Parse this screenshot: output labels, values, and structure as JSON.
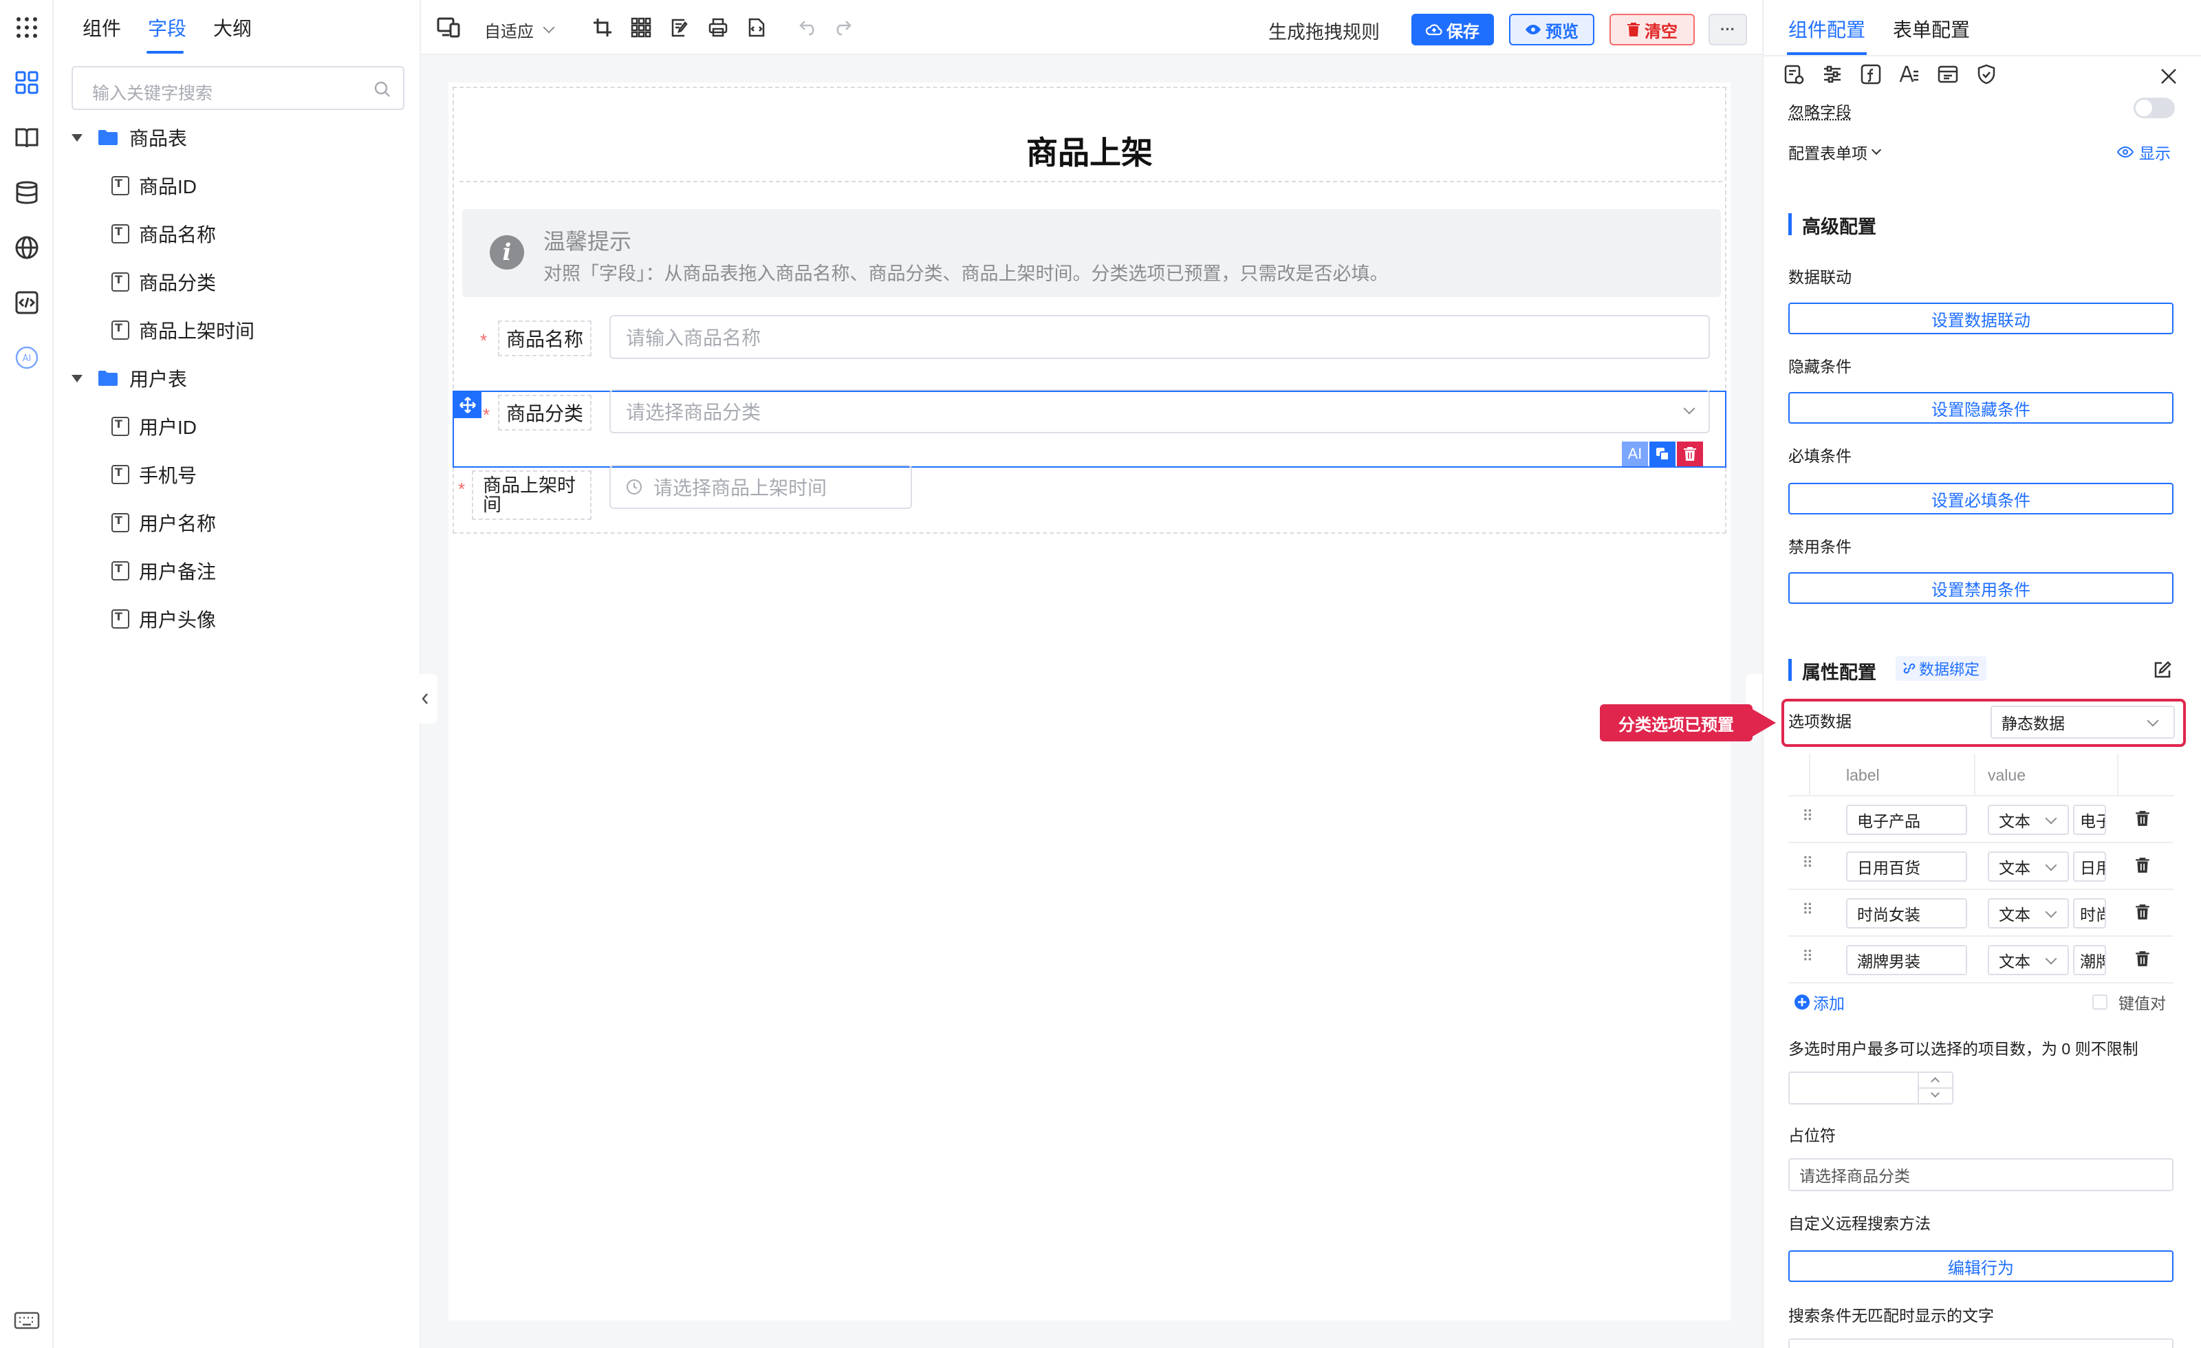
{
  "left_panel": {
    "tabs": [
      "组件",
      "字段",
      "大纲"
    ],
    "active_tab": "字段",
    "search_placeholder": "输入关键字搜索",
    "tree": [
      {
        "name": "商品表",
        "fields": [
          "商品ID",
          "商品名称",
          "商品分类",
          "商品上架时间"
        ]
      },
      {
        "name": "用户表",
        "fields": [
          "用户ID",
          "手机号",
          "用户名称",
          "用户备注",
          "用户头像"
        ]
      }
    ]
  },
  "toolbar": {
    "layout_mode": "自适应",
    "generate_rule": "生成拖拽规则",
    "save": "保存",
    "preview": "预览",
    "clear": "清空",
    "more": "···"
  },
  "form": {
    "title": "商品上架",
    "tip_title": "温馨提示",
    "tip_text": "对照「字段」：从商品表拖入商品名称、商品分类、商品上架时间。分类选项已预置，只需改是否必填。",
    "fields": [
      {
        "label": "商品名称",
        "placeholder": "请输入商品名称"
      },
      {
        "label": "商品分类",
        "placeholder": "请选择商品分类"
      },
      {
        "label": "商品上架时间",
        "placeholder": "请选择商品上架时间"
      }
    ],
    "ai_badge": "AI"
  },
  "annotation": {
    "text": "分类选项已预置"
  },
  "right_panel": {
    "tabs": [
      "组件配置",
      "表单配置"
    ],
    "active_tab": "组件配置",
    "ignore_field": "忽略字段",
    "config_item": "配置表单项",
    "show": "显示",
    "advanced_title": "高级配置",
    "advanced": [
      {
        "label": "数据联动",
        "button": "设置数据联动"
      },
      {
        "label": "隐藏条件",
        "button": "设置隐藏条件"
      },
      {
        "label": "必填条件",
        "button": "设置必填条件"
      },
      {
        "label": "禁用条件",
        "button": "设置禁用条件"
      }
    ],
    "props_title": "属性配置",
    "data_binding": "数据绑定",
    "option_data_label": "选项数据",
    "option_data_value": "静态数据",
    "col_label": "label",
    "col_value": "value",
    "options": [
      {
        "label": "电子产品",
        "type": "文本",
        "value": "电子产品"
      },
      {
        "label": "日用百货",
        "type": "文本",
        "value": "日用百货"
      },
      {
        "label": "时尚女装",
        "type": "文本",
        "value": "时尚女装"
      },
      {
        "label": "潮牌男装",
        "type": "文本",
        "value": "潮牌男装"
      }
    ],
    "add": "添加",
    "kv_pair": "键值对",
    "max_select": "多选时用户最多可以选择的项目数，为 0 则不限制",
    "placeholder_label": "占位符",
    "placeholder_value": "请选择商品分类",
    "remote_search": "自定义远程搜索方法",
    "edit_behavior": "编辑行为",
    "no_match_text": "搜索条件无匹配时显示的文字"
  },
  "colors": {
    "primary": "#1f6fff",
    "danger": "#f56c6c",
    "annotation": "#e0264d"
  }
}
